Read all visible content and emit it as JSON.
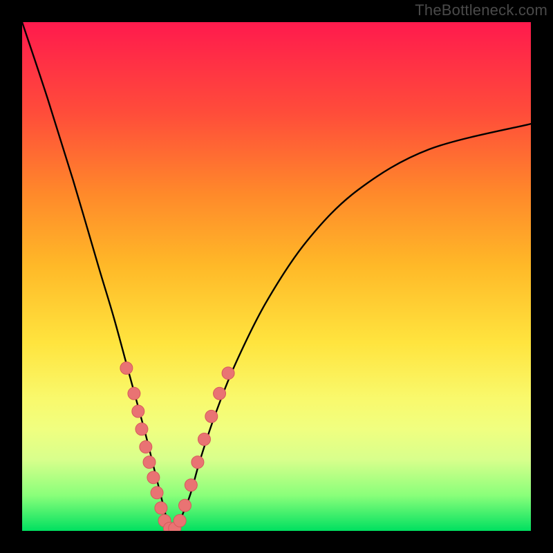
{
  "watermark": "TheBottleneck.com",
  "colors": {
    "curve": "#000000",
    "marker_fill": "#e97373",
    "marker_stroke": "#d55a5a",
    "frame_black": "#000000"
  },
  "chart_data": {
    "type": "line",
    "title": "",
    "xlabel": "",
    "ylabel": "",
    "xlim": [
      0,
      1
    ],
    "ylim": [
      0,
      1
    ],
    "note": "V-shaped bottleneck curve. Values are relative (0-1). y≈0 at the bottom (good / green), y≈1 at top (bad / red). x is a normalized component-balance axis. The minimum sits near x≈0.29.",
    "series": [
      {
        "name": "bottleneck-curve",
        "x": [
          0.0,
          0.05,
          0.1,
          0.15,
          0.18,
          0.21,
          0.24,
          0.26,
          0.28,
          0.29,
          0.3,
          0.31,
          0.33,
          0.35,
          0.38,
          0.42,
          0.48,
          0.56,
          0.66,
          0.8,
          1.0
        ],
        "y": [
          1.0,
          0.85,
          0.69,
          0.52,
          0.42,
          0.31,
          0.2,
          0.12,
          0.04,
          0.0,
          0.0,
          0.02,
          0.07,
          0.14,
          0.23,
          0.33,
          0.45,
          0.57,
          0.67,
          0.75,
          0.8
        ]
      }
    ],
    "markers": {
      "name": "sampled-configs",
      "note": "Pink dots clustered near the curve minimum on both branches.",
      "points": [
        {
          "x": 0.205,
          "y": 0.32
        },
        {
          "x": 0.22,
          "y": 0.27
        },
        {
          "x": 0.228,
          "y": 0.235
        },
        {
          "x": 0.235,
          "y": 0.2
        },
        {
          "x": 0.243,
          "y": 0.165
        },
        {
          "x": 0.25,
          "y": 0.135
        },
        {
          "x": 0.258,
          "y": 0.105
        },
        {
          "x": 0.265,
          "y": 0.075
        },
        {
          "x": 0.273,
          "y": 0.045
        },
        {
          "x": 0.28,
          "y": 0.02
        },
        {
          "x": 0.29,
          "y": 0.005
        },
        {
          "x": 0.3,
          "y": 0.005
        },
        {
          "x": 0.31,
          "y": 0.02
        },
        {
          "x": 0.32,
          "y": 0.05
        },
        {
          "x": 0.332,
          "y": 0.09
        },
        {
          "x": 0.345,
          "y": 0.135
        },
        {
          "x": 0.358,
          "y": 0.18
        },
        {
          "x": 0.372,
          "y": 0.225
        },
        {
          "x": 0.388,
          "y": 0.27
        },
        {
          "x": 0.405,
          "y": 0.31
        }
      ]
    }
  }
}
